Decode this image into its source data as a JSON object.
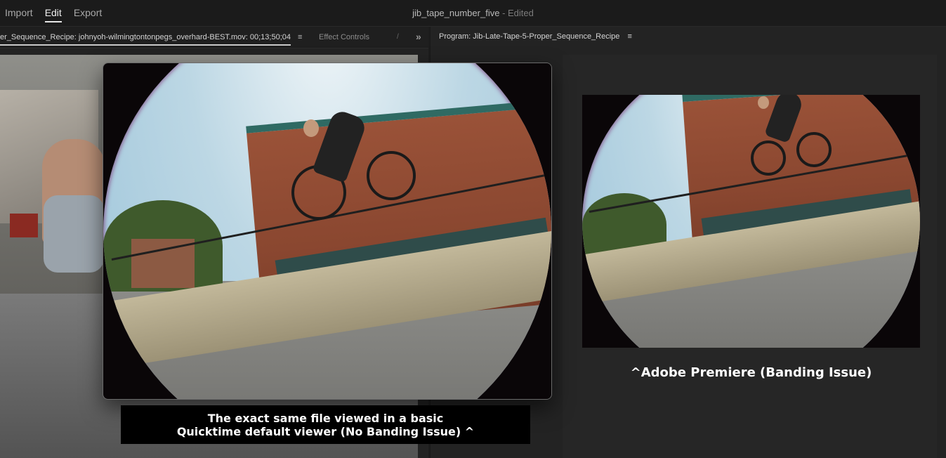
{
  "top_nav": {
    "import": "Import",
    "edit": "Edit",
    "export": "Export"
  },
  "document": {
    "name": "jib_tape_number_five",
    "status": "- Edited"
  },
  "source_panel": {
    "tab_title": "er_Sequence_Recipe: johnyoh-wilmingtontonpegs_overhard-BEST.mov: 00;13;50;04",
    "menu_glyph": "≡",
    "effect_controls": "Effect Controls",
    "overflow": "»"
  },
  "program_panel": {
    "tab_title": "Program: Jib-Late-Tape-5-Proper_Sequence_Recipe",
    "menu_glyph": "≡"
  },
  "captions": {
    "quicktime_line1": "The exact same file viewed in a basic",
    "quicktime_line2": "Quicktime default viewer (No Banding Issue) ^",
    "premiere": "^Adobe Premiere (Banding Issue)"
  }
}
